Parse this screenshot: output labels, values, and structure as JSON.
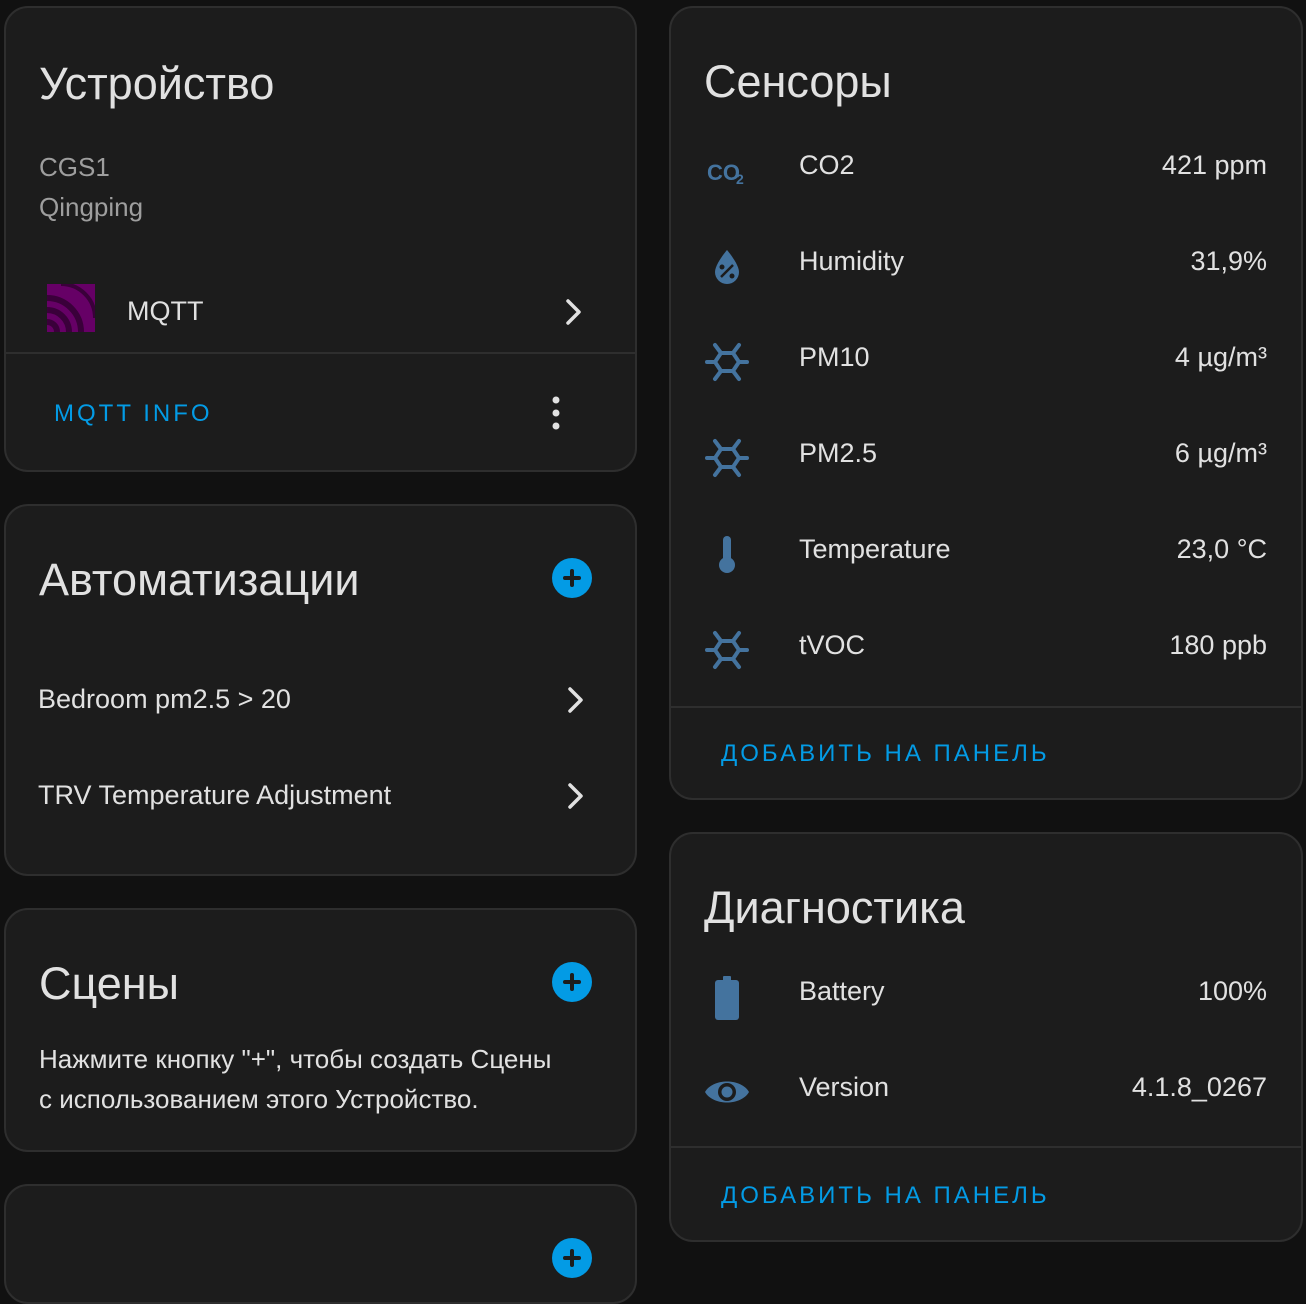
{
  "device_card": {
    "title": "Устройство",
    "model": "CGS1",
    "manufacturer": "Qingping",
    "integration": {
      "label": "MQTT",
      "icon": "mqtt-logo-icon"
    },
    "action_label": "MQTT INFO",
    "menu_icon": "more-vertical-icon"
  },
  "automations_card": {
    "title": "Автоматизации",
    "add_icon": "plus-circle-icon",
    "items": [
      {
        "label": "Bedroom pm2.5 > 20"
      },
      {
        "label": "TRV Temperature Adjustment"
      }
    ]
  },
  "scenes_card": {
    "title": "Сцены",
    "add_icon": "plus-circle-icon",
    "empty_line_1": "Нажмите кнопку \"+\", чтобы создать Сцены",
    "empty_line_2": "с использованием этого Устройство."
  },
  "sensors_card": {
    "title": "Сенсоры",
    "items": [
      {
        "label": "CO2",
        "value": "421 ppm",
        "icon": "molecule-co2-icon"
      },
      {
        "label": "Humidity",
        "value": "31,9%",
        "icon": "water-percent-icon"
      },
      {
        "label": "PM10",
        "value": "4 µg/m³",
        "icon": "molecule-icon"
      },
      {
        "label": "PM2.5",
        "value": "6 µg/m³",
        "icon": "molecule-icon"
      },
      {
        "label": "Temperature",
        "value": "23,0 °C",
        "icon": "thermometer-icon"
      },
      {
        "label": "tVOC",
        "value": "180 ppb",
        "icon": "molecule-icon"
      }
    ],
    "action_label": "ДОБАВИТЬ НА ПАНЕЛЬ"
  },
  "diagnostics_card": {
    "title": "Диагностика",
    "items": [
      {
        "label": "Battery",
        "value": "100%",
        "icon": "battery-icon"
      },
      {
        "label": "Version",
        "value": "4.1.8_0267",
        "icon": "eye-icon"
      }
    ],
    "action_label": "ДОБАВИТЬ НА ПАНЕЛЬ"
  },
  "colors": {
    "accent": "#039be5",
    "icon": "#44739e",
    "card_bg": "#1c1c1c",
    "page_bg": "#111111",
    "mqtt_logo": "#660066"
  }
}
